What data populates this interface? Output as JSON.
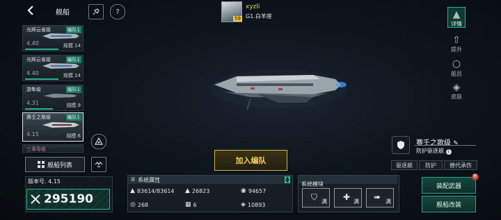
{
  "header": {
    "title": "舰船",
    "back_icon": "chevron-left-icon",
    "rocket_icon": "rocket-icon",
    "help_label": "?"
  },
  "player": {
    "name": "xyzli",
    "server": "G1.白羊座",
    "level": "59"
  },
  "ship_list": [
    {
      "name": "光辉云雀级",
      "fleet": "编队1",
      "level": "4.40",
      "scale": "规模.14"
    },
    {
      "name": "光辉云雀级",
      "fleet": "编队1",
      "level": "4.40",
      "scale": "规模.14"
    },
    {
      "name": "游隼级",
      "fleet": "编队1",
      "level": "4.31",
      "scale": "规模.9"
    },
    {
      "name": "赛壬之歌级",
      "fleet": "编队1",
      "level": "4.15",
      "scale": "规模.6"
    },
    {
      "name": "三事导级",
      "fleet": "",
      "level": "",
      "scale": ""
    }
  ],
  "fleet_list_label": "舰船列表",
  "version": "版本号. 4.15",
  "power": "295190",
  "add_to_fleet_label": "加入编队",
  "right_nav": [
    {
      "label": "详情",
      "icon": "details-icon"
    },
    {
      "label": "提升",
      "icon": "upgrade-icon"
    },
    {
      "label": "船员",
      "icon": "crew-icon"
    },
    {
      "label": "皮肤",
      "icon": "skin-icon"
    }
  ],
  "ship_info": {
    "name": "赛壬之歌级",
    "subtitle": "防护驱逐舰",
    "tags": [
      "驱逐舰",
      "防护",
      "替代承伤"
    ]
  },
  "system_attrs": {
    "title": "系统属性",
    "values": [
      "83614/83614",
      "26823",
      "94657",
      "268",
      "6",
      "10893"
    ]
  },
  "system_modules": {
    "title": "系统模块",
    "slots": [
      "满",
      "满",
      "满"
    ]
  },
  "buttons": {
    "equip": "装配武器",
    "refit": "舰船改装",
    "new_badge": "新"
  },
  "colors": {
    "accent_green": "#2ab38f",
    "gold": "#d8b24a",
    "panel": "#182028"
  }
}
